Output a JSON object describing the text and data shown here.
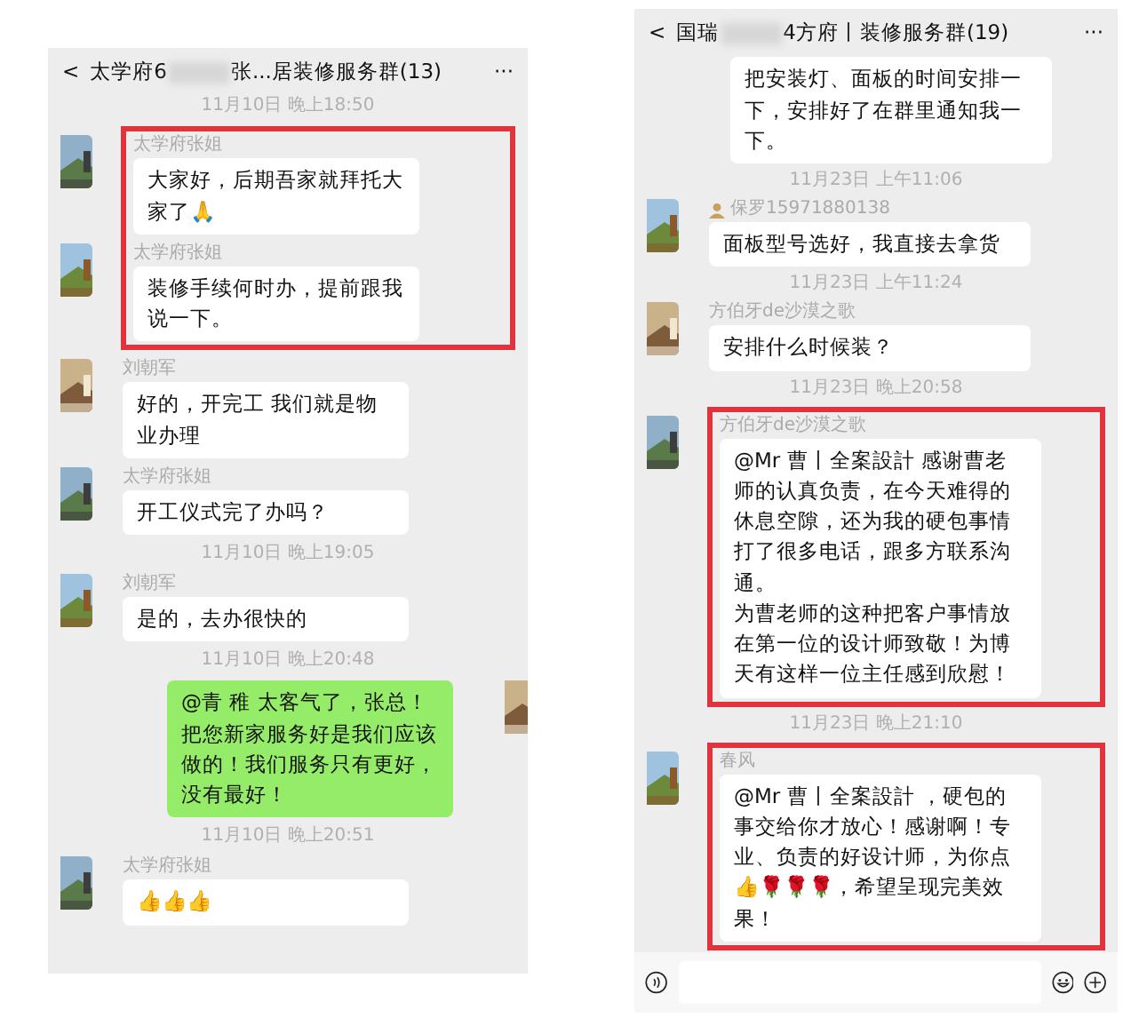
{
  "chats": [
    {
      "title_start": "太学府6",
      "title_end": "张...居装修服务群(13)",
      "back": "<",
      "more": "···",
      "items": [
        {
          "kind": "time",
          "text": "11月10日 晚上18:50"
        },
        {
          "kind": "message",
          "sender": "太学府张姐",
          "paragraphs": [
            "大家好，后期吾家就拜托大家了🙏"
          ],
          "mine": false,
          "highlighted": true
        },
        {
          "kind": "message",
          "sender": "太学府张姐",
          "paragraphs": [
            "装修手续何时办，提前跟我说一下。"
          ],
          "mine": false,
          "highlighted": true
        },
        {
          "kind": "message",
          "sender": "刘朝军",
          "paragraphs": [
            "好的，开完工 我们就是物业办理"
          ],
          "mine": false,
          "highlighted": false
        },
        {
          "kind": "message",
          "sender": "太学府张姐",
          "paragraphs": [
            "开工仪式完了办吗？"
          ],
          "mine": false,
          "highlighted": false
        },
        {
          "kind": "time",
          "text": "11月10日 晚上19:05"
        },
        {
          "kind": "message",
          "sender": "刘朝军",
          "paragraphs": [
            "是的，去办很快的"
          ],
          "mine": false,
          "highlighted": false
        },
        {
          "kind": "time",
          "text": "11月10日 晚上20:48"
        },
        {
          "kind": "message",
          "paragraphs": [
            "@青 稚  太客气了，张总！把您新家服务好是我们应该做的！我们服务只有更好，没有最好！"
          ],
          "mine": true,
          "highlighted": false
        },
        {
          "kind": "time",
          "text": "11月10日 晚上20:51"
        },
        {
          "kind": "message",
          "sender": "太学府张姐",
          "paragraphs": [
            "👍👍👍"
          ],
          "mine": false,
          "highlighted": false
        }
      ]
    },
    {
      "title_start": "国瑞",
      "title_end": "4方府丨装修服务群(19)",
      "back": "<",
      "more": "···",
      "items": [
        {
          "kind": "message",
          "paragraphs": [
            "把安装灯、面板的时间安排一下，安排好了在群里通知我一下。"
          ],
          "mine": false,
          "highlighted": false
        },
        {
          "kind": "time",
          "text": "11月23日 上午11:06"
        },
        {
          "kind": "message",
          "sender": "保罗15971880138",
          "name_icon": true,
          "paragraphs": [
            "面板型号选好，我直接去拿货"
          ],
          "mine": false,
          "highlighted": false
        },
        {
          "kind": "time",
          "text": "11月23日 上午11:24"
        },
        {
          "kind": "message",
          "sender": "方伯牙de沙漠之歌",
          "paragraphs": [
            "安排什么时候装？"
          ],
          "mine": false,
          "highlighted": false
        },
        {
          "kind": "time",
          "text": "11月23日 晚上20:58"
        },
        {
          "kind": "message",
          "sender": "方伯牙de沙漠之歌",
          "paragraphs": [
            "@Mr 曹丨全案設計  感谢曹老师的认真负责，在今天难得的休息空隙，还为我的硬包事情打了很多电话，跟多方联系沟通。",
            "为曹老师的这种把客户事情放在第一位的设计师致敬！为博天有这样一位主任感到欣慰！"
          ],
          "mine": false,
          "highlighted": true
        },
        {
          "kind": "time",
          "text": "11月23日 晚上21:10"
        },
        {
          "kind": "message",
          "sender": "春风",
          "paragraphs": [
            "@Mr 曹丨全案設計 ，硬包的事交给你才放心！感谢啊！专业、负责的好设计师，为你点👍🌹🌹🌹，希望呈现完美效果！"
          ],
          "mine": false,
          "highlighted": true
        }
      ],
      "input_bar": true
    }
  ]
}
